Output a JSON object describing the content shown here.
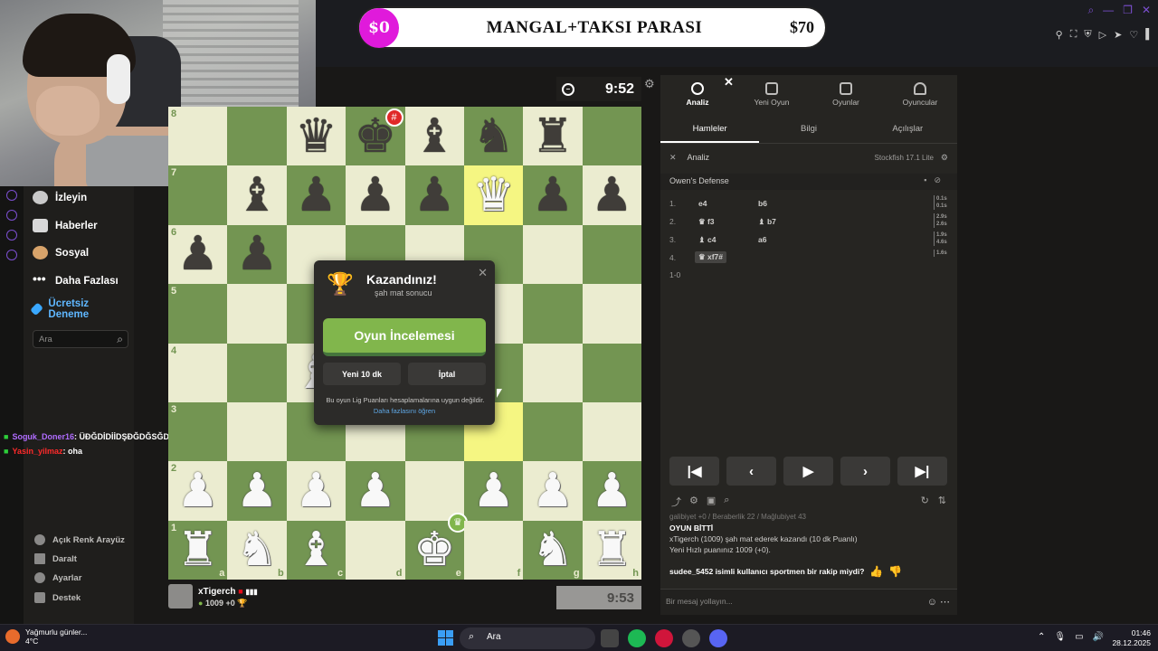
{
  "donation": {
    "start": "$0",
    "title": "MANGAL+TAKSI PARASI",
    "goal": "$70"
  },
  "sidebar": {
    "items": [
      {
        "label": "İzleyin"
      },
      {
        "label": "Haberler"
      },
      {
        "label": "Sosyal"
      },
      {
        "label": "Daha Fazlası"
      },
      {
        "label": "Ücretsiz Deneme"
      }
    ],
    "search_placeholder": "Ara",
    "bottom": [
      {
        "label": "Açık Renk Arayüz"
      },
      {
        "label": "Daralt"
      },
      {
        "label": "Ayarlar"
      },
      {
        "label": "Destek"
      }
    ]
  },
  "chat_overlay": [
    {
      "user": "Soguk_Doner16",
      "text": ": ÜĐĞDİDİİDŞĐĞDĞSĞDĞDĞDĞCĞDĞSPSPSĞ",
      "color": "#b06cff"
    },
    {
      "user": "Yasin_yilmaz",
      "text": ": oha",
      "color": "#ff2a2a"
    }
  ],
  "top_clock": "9:52",
  "board": {
    "ranks": [
      "8",
      "7",
      "6",
      "5",
      "4",
      "3",
      "2",
      "1"
    ],
    "files": [
      "a",
      "b",
      "c",
      "d",
      "e",
      "f",
      "g",
      "h"
    ],
    "rows": [
      [
        "",
        "",
        "bq",
        "bk",
        "bb",
        "bn",
        "br",
        ""
      ],
      [
        "",
        "bb",
        "bp",
        "bp",
        "bp",
        "wq",
        "bp",
        "bp"
      ],
      [
        "bp",
        "bp",
        "",
        "",
        "",
        "",
        "",
        ""
      ],
      [
        "",
        "",
        "",
        "",
        "",
        "",
        "",
        ""
      ],
      [
        "",
        "",
        "wb",
        "",
        "",
        "",
        "",
        ""
      ],
      [
        "",
        "",
        "",
        "",
        "",
        "",
        "",
        ""
      ],
      [
        "wp",
        "wp",
        "wp",
        "wp",
        "",
        "wp",
        "wp",
        "wp"
      ],
      [
        "wr",
        "wn",
        "wb",
        "",
        "wk",
        "",
        "wn",
        "wr"
      ]
    ],
    "highlights": [
      "f7",
      "f3"
    ]
  },
  "modal": {
    "title": "Kazandınız!",
    "subtitle": "şah mat sonucu",
    "review_label": "Oyun İncelemesi",
    "new_game_label": "Yeni 10 dk",
    "cancel_label": "İptal",
    "note": "Bu oyun Lig Puanları hesaplamalarına uygun değildir.",
    "link": "Daha fazlasını öğren"
  },
  "player": {
    "name": "xTigerch",
    "rating": "1009 +0",
    "clock": "9:53"
  },
  "panel": {
    "tabs": [
      {
        "label": "Analiz"
      },
      {
        "label": "Yeni Oyun"
      },
      {
        "label": "Oyunlar"
      },
      {
        "label": "Oyuncular"
      }
    ],
    "sub_tabs": [
      "Hamleler",
      "Bilgi",
      "Açılışlar"
    ],
    "analysis_label": "Analiz",
    "engine": "Stockfish 17.1 Lite",
    "opening": "Owen's Defense",
    "moves": [
      {
        "num": "1.",
        "white": "e4",
        "black": "b6",
        "t1": "0.1s",
        "t2": "0.1s"
      },
      {
        "num": "2.",
        "white": "♛ f3",
        "black": "♝ b7",
        "t1": "2.9s",
        "t2": "2.6s"
      },
      {
        "num": "3.",
        "white": "♝ c4",
        "black": "a6",
        "t1": "1.9s",
        "t2": "4.6s"
      },
      {
        "num": "4.",
        "white": "♛ xf7#",
        "black": "",
        "t1": "1.6s",
        "t2": ""
      }
    ],
    "result": "1-0",
    "chat_faded": "galibiyet +0 / Beraberlik 22 / Mağlubiyet 43",
    "chat_header": "OYUN BİTTİ",
    "chat_line1": "xTigerch (1009) şah mat ederek kazandı (10 dk Puanlı)",
    "chat_line2": "Yeni Hızlı puanınız 1009 (+0).",
    "chat_question": "sudee_5452 isimli kullanıcı sportmen bir rakip miydi?",
    "message_placeholder": "Bir mesaj yollayın..."
  },
  "taskbar": {
    "weather_title": "Yağmurlu günler...",
    "weather_temp": "4°C",
    "search": "Ara",
    "time": "01:46",
    "date": "28.12.2025"
  }
}
